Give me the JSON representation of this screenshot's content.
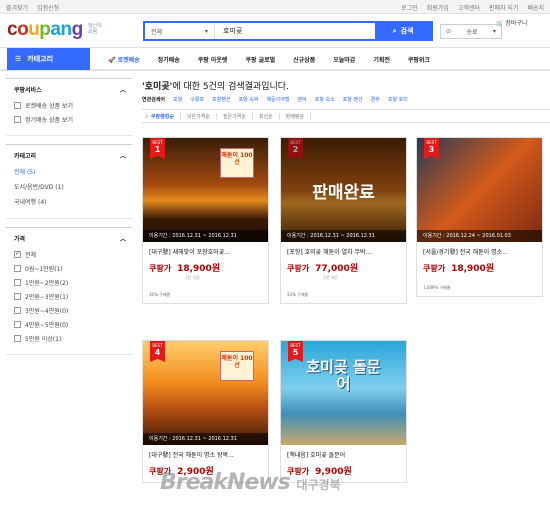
{
  "topbar": {
    "left": [
      "즐겨찾기",
      "입점신청"
    ],
    "right": [
      "로그인",
      "회원가입",
      "고객센터",
      "판매자 되기",
      "배송지"
    ]
  },
  "header": {
    "logo_letters": [
      {
        "ch": "c",
        "color": "#8b2b1b"
      },
      {
        "ch": "o",
        "color": "#cf2f27"
      },
      {
        "ch": "u",
        "color": "#f5a623"
      },
      {
        "ch": "p",
        "color": "#76b72a"
      },
      {
        "ch": "a",
        "color": "#1ea2da"
      },
      {
        "ch": "n",
        "color": "#1ea2da"
      },
      {
        "ch": "g",
        "color": "#6b3fa0"
      }
    ],
    "logo_sub": [
      "당신의",
      "쇼핑"
    ],
    "search_category": "전체",
    "search_value": "호미곶",
    "search_button": "검색",
    "location": "송료",
    "cart_label": "장바구니"
  },
  "nav": {
    "category_label": "카테고리",
    "items": [
      "로켓배송",
      "정기배송",
      "쿠팡 아웃렛",
      "쿠팡 글로벌",
      "신규상품",
      "오늘마감",
      "기획전",
      "쿠팡위크"
    ]
  },
  "sidebar": {
    "service_title": "쿠팡서비스",
    "services": [
      "로켓배송 상품 보기",
      "정기배송 상품 보기"
    ],
    "category_title": "카테고리",
    "categories": [
      {
        "label": "전체 (5)",
        "on": true
      },
      {
        "label": "도서/음반/DVD (1)",
        "on": false
      },
      {
        "label": "국내여행 (4)",
        "on": false
      }
    ],
    "price_title": "가격",
    "prices": [
      {
        "label": "전체",
        "checked": true
      },
      {
        "label": "0원~1만원(1)",
        "checked": false
      },
      {
        "label": "1만원~2만원(2)",
        "checked": false
      },
      {
        "label": "2만원~3만원(1)",
        "checked": false
      },
      {
        "label": "3만원~4만원(0)",
        "checked": false
      },
      {
        "label": "4만원~5만원(0)",
        "checked": false
      },
      {
        "label": "5만원 이상(1)",
        "checked": false
      }
    ]
  },
  "main": {
    "result_query": "'호미곶'",
    "result_rest": "에 대한 5건의 검색결과입니다.",
    "related_label": "연관검색어",
    "related": [
      "포항",
      "구룡포",
      "포항펜션",
      "포항 숙박",
      "해돋이여행",
      "영덕",
      "포항 숙소",
      "포항 펜션",
      "경주",
      "포항 호미"
    ],
    "sort_options": [
      "✓ 쿠팡랭킹순",
      "낮은가격순",
      "높은가격순",
      "최신순",
      "판매량순"
    ],
    "products": [
      {
        "rank": "1",
        "period": "이용기간 : 2016.12.31 ~ 2016.12.31",
        "title": "[대구發] 새해맞이 포항호미곶...",
        "price": "18,900원",
        "sub": "1인 기준",
        "review": "30% 구매율",
        "soldout": false,
        "book": "해돋이 100선"
      },
      {
        "rank": "2",
        "period": "이용기간 : 2016.12.31 ~ 2016.12.31",
        "title": "[포항] 호미곶 해돋이 열차 무박...",
        "price": "77,000원",
        "sub": "1인 기준",
        "review": "33% 구매율",
        "soldout": true,
        "book": ""
      },
      {
        "rank": "3",
        "period": "이용기간 : 2016.12.24 ~ 2016.01.03",
        "title": "[서울/경기發] 전국 해돋이 명소...",
        "price": "18,900원",
        "sub": "",
        "review": "1,089% 구매율",
        "soldout": false,
        "book": ""
      },
      {
        "rank": "4",
        "period": "이용기간 : 2016.12.31 ~ 2016.12.31",
        "title": "[대구發] 전국 해돋이 명소 왕복...",
        "price": "2,900원",
        "sub": "",
        "review": "",
        "soldout": false,
        "book": "해돋이 100선"
      },
      {
        "rank": "5",
        "period": "",
        "title": "[책내음] 호미곶 돌문어",
        "price": "9,900원",
        "sub": "",
        "review": "",
        "soldout": false,
        "book": ""
      }
    ],
    "price_label": "쿠팡가",
    "badge_label": "BEST",
    "soldout_label": "판매완료",
    "book_cover_title": "호미곶 돌문어"
  },
  "watermark": {
    "main": "BreakNews",
    "sub": "대구경북"
  }
}
